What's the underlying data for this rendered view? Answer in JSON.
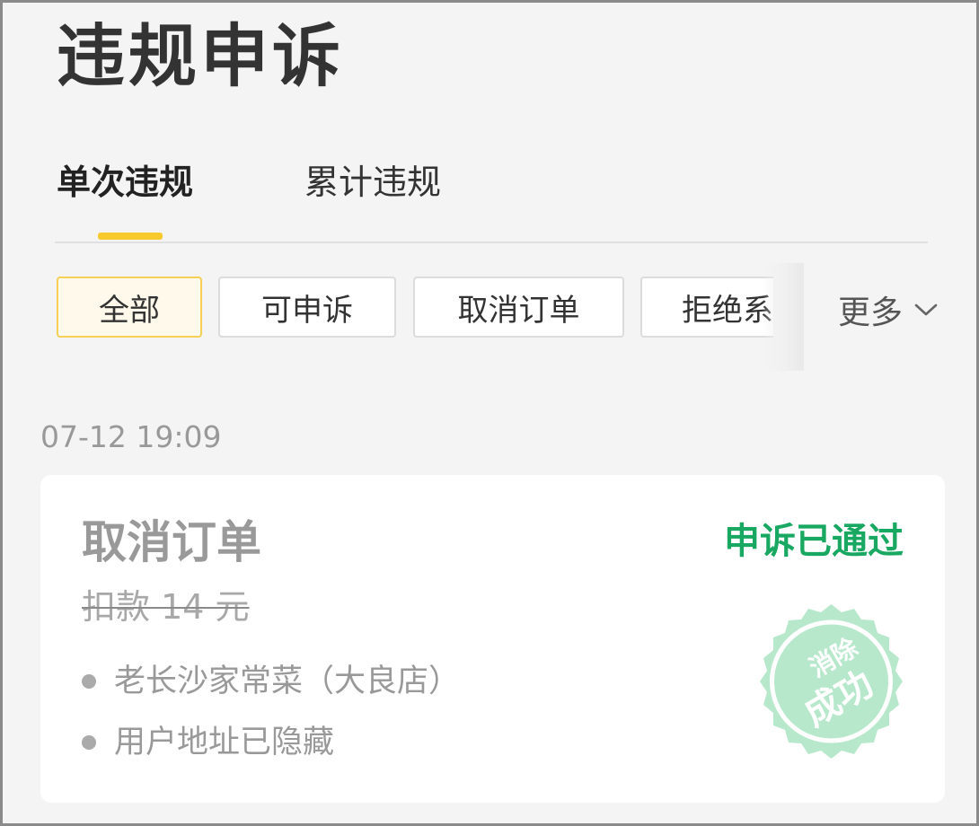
{
  "page": {
    "title": "违规申诉"
  },
  "tabs": [
    {
      "label": "单次违规",
      "active": true
    },
    {
      "label": "累计违规",
      "active": false
    }
  ],
  "filters": {
    "chips": [
      {
        "label": "全部",
        "active": true
      },
      {
        "label": "可申诉",
        "active": false
      },
      {
        "label": "取消订单",
        "active": false
      },
      {
        "label": "拒绝系",
        "active": false
      }
    ],
    "more_label": "更多",
    "more_icon": "chevron-down-icon"
  },
  "records": [
    {
      "time": "07-12 19:09",
      "type": "取消订单",
      "status": "申诉已通过",
      "status_color": "#19a862",
      "deduction": "扣款 14 元",
      "store": "老长沙家常菜（大良店）",
      "address": "用户地址已隐藏",
      "stamp": {
        "line1": "消除",
        "line2": "成功",
        "color": "#b8e8cc"
      }
    }
  ],
  "colors": {
    "accent": "#f8c92c",
    "background": "#f4f4f4",
    "success": "#19a862"
  }
}
